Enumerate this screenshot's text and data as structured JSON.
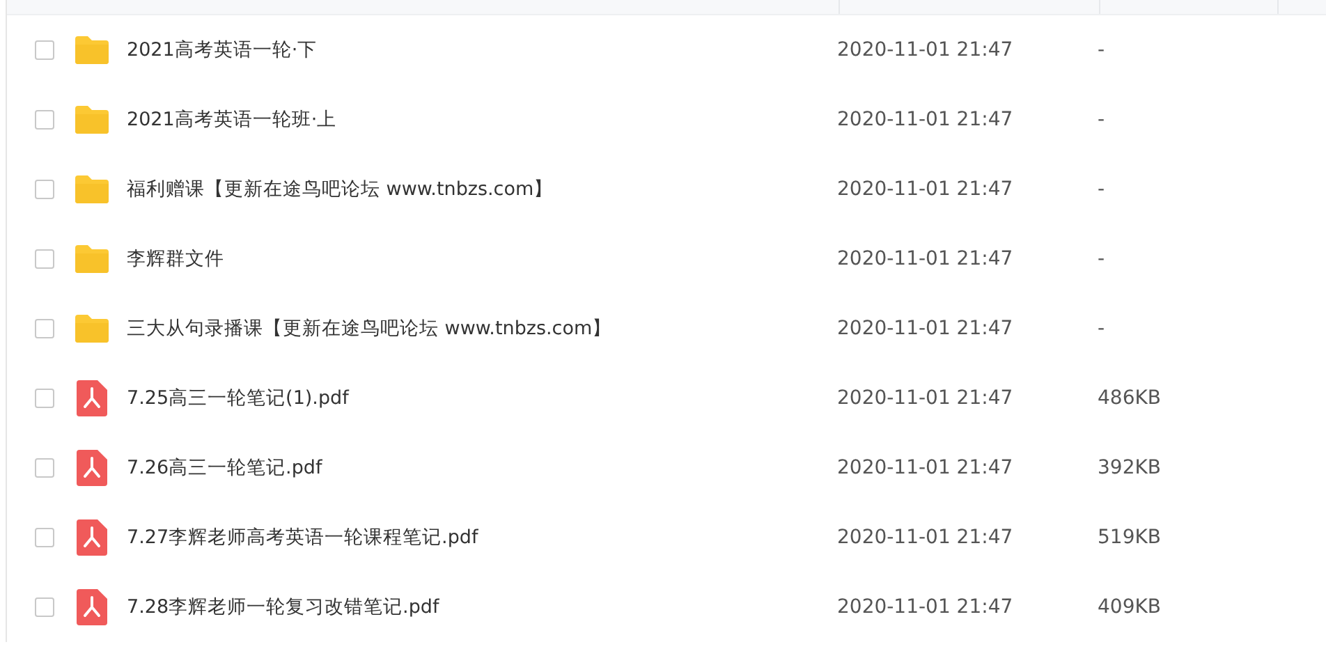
{
  "files": [
    {
      "kind": "folder",
      "checked": false,
      "name": "2021高考英语一轮·下",
      "modified": "2020-11-01 21:47",
      "size": "-"
    },
    {
      "kind": "folder",
      "checked": false,
      "name": "2021高考英语一轮班·上",
      "modified": "2020-11-01 21:47",
      "size": "-"
    },
    {
      "kind": "folder",
      "checked": false,
      "name": "福利赠课【更新在途鸟吧论坛 www.tnbzs.com】",
      "modified": "2020-11-01 21:47",
      "size": "-"
    },
    {
      "kind": "folder",
      "checked": false,
      "name": "李辉群文件",
      "modified": "2020-11-01 21:47",
      "size": "-"
    },
    {
      "kind": "folder",
      "checked": false,
      "name": "三大从句录播课【更新在途鸟吧论坛 www.tnbzs.com】",
      "modified": "2020-11-01 21:47",
      "size": "-"
    },
    {
      "kind": "pdf",
      "checked": false,
      "name": "7.25高三一轮笔记(1).pdf",
      "modified": "2020-11-01 21:47",
      "size": "486KB"
    },
    {
      "kind": "pdf",
      "checked": false,
      "name": "7.26高三一轮笔记.pdf",
      "modified": "2020-11-01 21:47",
      "size": "392KB"
    },
    {
      "kind": "pdf",
      "checked": false,
      "name": "7.27李辉老师高考英语一轮课程笔记.pdf",
      "modified": "2020-11-01 21:47",
      "size": "519KB"
    },
    {
      "kind": "pdf",
      "checked": false,
      "name": "7.28李辉老师一轮复习改错笔记.pdf",
      "modified": "2020-11-01 21:47",
      "size": "409KB"
    }
  ]
}
